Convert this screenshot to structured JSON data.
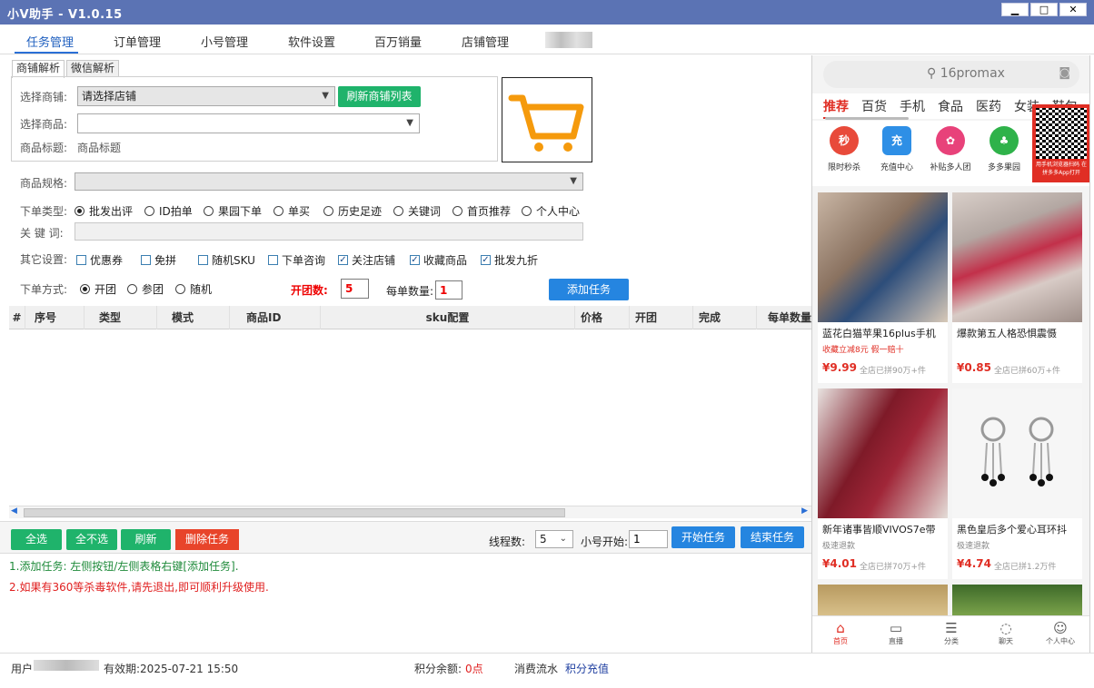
{
  "window": {
    "title": "小V助手 - V1.0.15",
    "min_label": "▁",
    "max_label": "□",
    "close_label": "✕"
  },
  "main_tabs": [
    "任务管理",
    "订单管理",
    "小号管理",
    "软件设置",
    "百万销量",
    "店铺管理"
  ],
  "sub_tabs": [
    "商铺解析",
    "微信解析"
  ],
  "form": {
    "shop_label": "选择商铺:",
    "shop_value": "请选择店铺",
    "refresh_shops_button": "刷新商铺列表",
    "product_label": "选择商品:",
    "product_value": "",
    "title_label": "商品标题:",
    "title_value": "商品标题",
    "spec_label": "商品规格:",
    "order_type_label": "下单类型:",
    "order_types": [
      "批发出评",
      "ID拍单",
      "果园下单",
      "单买",
      "历史足迹",
      "关键词",
      "首页推荐",
      "个人中心"
    ],
    "keyword_label": "关 键 词:",
    "other_label": "其它设置:",
    "other_options": [
      {
        "label": "优惠券",
        "checked": false
      },
      {
        "label": "免拼",
        "checked": false
      },
      {
        "label": "随机SKU",
        "checked": false
      },
      {
        "label": "下单咨询",
        "checked": false
      },
      {
        "label": "关注店铺",
        "checked": true
      },
      {
        "label": "收藏商品",
        "checked": true
      },
      {
        "label": "批发九折",
        "checked": true
      }
    ],
    "order_mode_label": "下单方式:",
    "order_modes": [
      "开团",
      "参团",
      "随机"
    ],
    "group_count_label": "开团数:",
    "group_count_value": "5",
    "per_order_label": "每单数量:",
    "per_order_value": "1",
    "add_task_button": "添加任务"
  },
  "table": {
    "columns": [
      "#",
      "序号",
      "类型",
      "模式",
      "商品ID",
      "sku配置",
      "价格",
      "开团",
      "完成",
      "每单数量"
    ]
  },
  "actions": {
    "select_all": "全选",
    "select_none": "全不选",
    "refresh": "刷新",
    "delete_task": "删除任务",
    "threads_label": "线程数:",
    "threads_value": "5",
    "account_start_label": "小号开始:",
    "account_start_value": "1",
    "start_task": "开始任务",
    "end_task": "结束任务"
  },
  "log": {
    "line1": "1.添加任务: 左侧按钮/左侧表格右键[添加任务].",
    "line2": "2.如果有360等杀毒软件,请先退出,即可顺利升级使用."
  },
  "status": {
    "user_label": "用户",
    "expiry": "有效期:2025-07-21 15:50",
    "balance_label": "积分余额:",
    "balance_value": "0点",
    "consume_flow": "消费流水",
    "recharge": "积分充值"
  },
  "store": {
    "search_placeholder": "16promax",
    "categories": [
      "推荐",
      "百货",
      "手机",
      "食品",
      "医药",
      "女装",
      "鞋包"
    ],
    "quick_icons": [
      {
        "label": "限时秒杀",
        "glyph": "秒",
        "color": "#e84a3a"
      },
      {
        "label": "充值中心",
        "glyph": "充",
        "color": "#2e8fe6"
      },
      {
        "label": "补贴多人团",
        "glyph": "✿",
        "color": "#e8427a"
      },
      {
        "label": "多多果园",
        "glyph": "♣",
        "color": "#2fb24a"
      }
    ],
    "qr_caption": "用手机浏览器扫码 在拼多多App打开",
    "products": [
      {
        "name": "蓝花白猫苹果16plus手机",
        "tag": "收藏立减8元  假一赔十",
        "price": "¥9.99",
        "sold": "全店已拼90万+件"
      },
      {
        "name": "爆款第五人格恐惧震慑",
        "tag": "",
        "price": "¥0.85",
        "sold": "全店已拼60万+件"
      },
      {
        "name": "新年诸事皆顺VIVOS7e带",
        "tag": "极速退款",
        "price": "¥4.01",
        "sold": "全店已拼70万+件"
      },
      {
        "name": "黑色皇后多个爱心耳环抖",
        "tag": "极速退款",
        "price": "¥4.74",
        "sold": "全店已拼1.2万件"
      }
    ],
    "bottom_nav": [
      "首页",
      "直播",
      "分类",
      "聊天",
      "个人中心"
    ]
  }
}
